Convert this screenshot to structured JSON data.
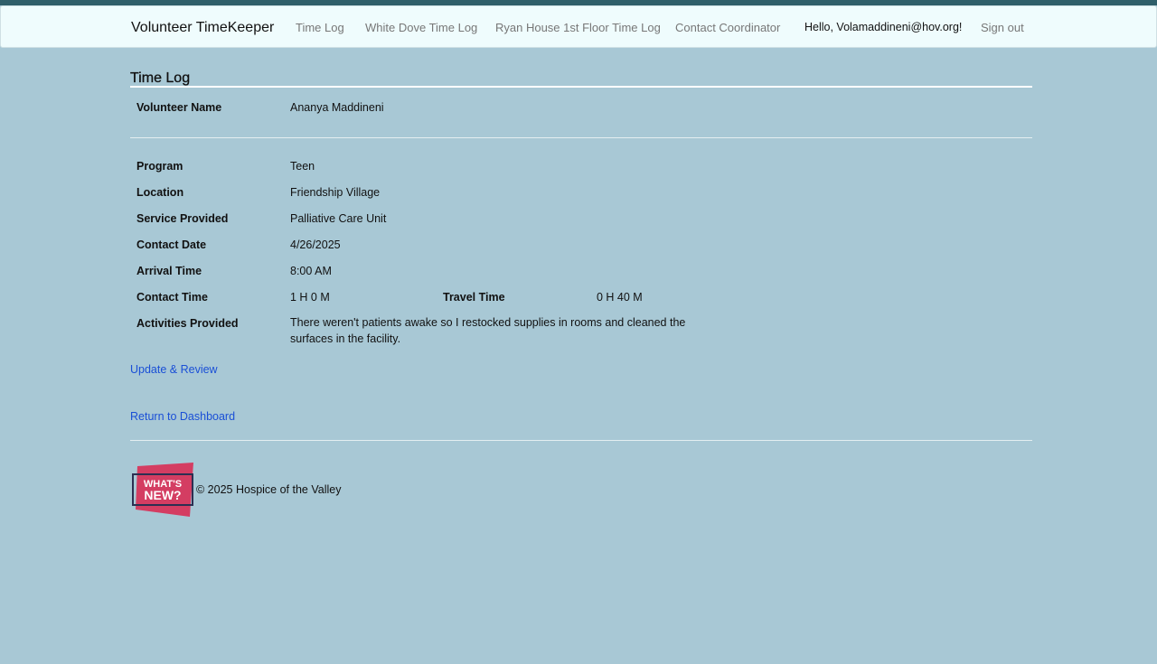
{
  "nav": {
    "brand": "Volunteer TimeKeeper",
    "links": [
      "Time Log",
      "White Dove Time Log",
      "Ryan House 1st Floor Time Log",
      "Contact Coordinator"
    ],
    "greeting": "Hello, Volamaddineni@hov.org!",
    "sign_out": "Sign out"
  },
  "page": {
    "title": "Time Log",
    "volunteer_label": "Volunteer Name",
    "volunteer_name": "Ananya Maddineni"
  },
  "details": {
    "program_label": "Program",
    "program": "Teen",
    "location_label": "Location",
    "location": "Friendship Village",
    "service_label": "Service Provided",
    "service": "Palliative Care Unit",
    "date_label": "Contact Date",
    "date": "4/26/2025",
    "arrival_label": "Arrival Time",
    "arrival": "8:00 AM",
    "contact_time_label": "Contact Time",
    "contact_time": "1 H 0 M",
    "travel_time_label": "Travel Time",
    "travel_time": "0 H 40 M",
    "activities_label": "Activities Provided",
    "activities": "There weren't patients awake so I restocked supplies in rooms and cleaned the surfaces in the facility."
  },
  "actions": {
    "update": "Update & Review",
    "return": "Return to Dashboard"
  },
  "footer": {
    "logo_text_top": "WHAT'S",
    "logo_text_bottom": "NEW?",
    "copyright": "© 2025 Hospice of the Valley"
  }
}
